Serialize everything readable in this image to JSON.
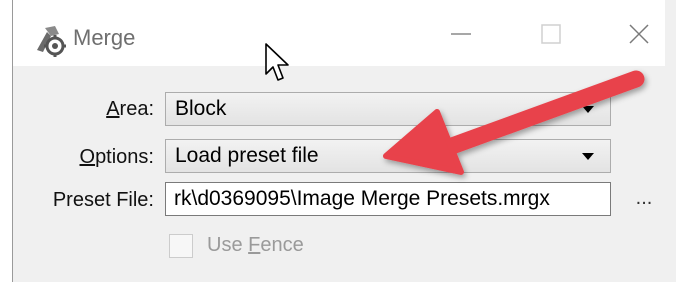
{
  "window": {
    "title": "Merge",
    "controls": {
      "minimize_icon": "minimize-icon",
      "maximize_icon": "maximize-icon",
      "close_icon": "close-icon"
    }
  },
  "form": {
    "area": {
      "label_accesskey": "A",
      "label_rest": "rea:",
      "value": "Block"
    },
    "options": {
      "label_accesskey": "O",
      "label_rest": "ptions:",
      "value": "Load preset file"
    },
    "preset_file": {
      "label": "Preset File:",
      "value": "rk\\d0369095\\Image Merge Presets.mrgx",
      "browse_label": "..."
    },
    "use_fence": {
      "label_before": "Use ",
      "label_accesskey": "F",
      "label_after": "ence",
      "checked": false,
      "enabled": false
    }
  },
  "annotation": {
    "arrow_color": "#e8434b"
  },
  "colors": {
    "window_bg": "#f0f0f0",
    "titlebar_bg": "#ffffff",
    "disabled_text": "#9a9a9a"
  }
}
